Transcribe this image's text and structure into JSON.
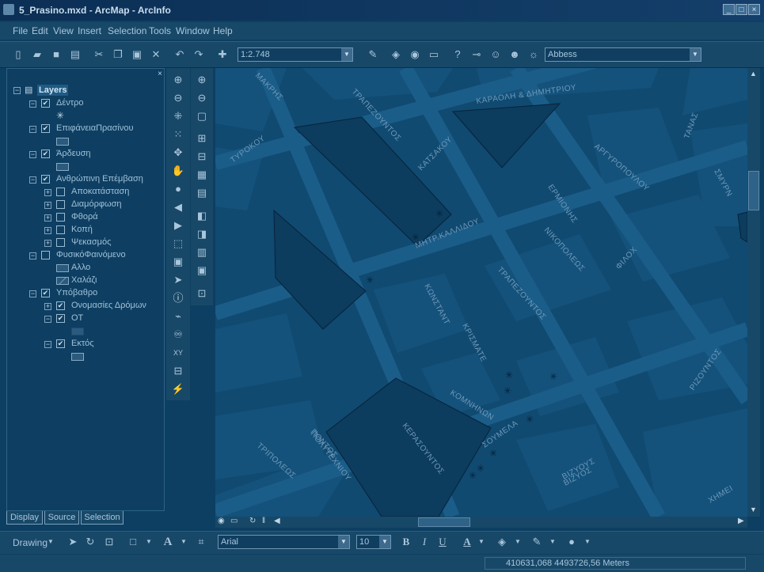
{
  "window": {
    "title": "5_Prasino.mxd - ArcMap - ArcInfo",
    "min": "_",
    "max": "□",
    "close": "×"
  },
  "menus": [
    "File",
    "Edit",
    "View",
    "Insert",
    "Selection",
    "Tools",
    "Window",
    "Help"
  ],
  "toolbar": {
    "scale": "1:2.748",
    "layer_combo": "Abbess"
  },
  "toc": {
    "root": "Layers",
    "rows": [
      {
        "label": "Δέντρο"
      },
      {
        "label": "ΕπιφάνειαΠρασίνου"
      },
      {
        "label": "Άρδευση"
      },
      {
        "label": "Ανθρώπινη Επέμβαση"
      },
      {
        "label": "Αποκατάσταση"
      },
      {
        "label": "Διαμόρφωση"
      },
      {
        "label": "Φθορά"
      },
      {
        "label": "Κοπή"
      },
      {
        "label": "Ψεκασμός"
      },
      {
        "label": "ΦυσικόΦαινόμενο"
      },
      {
        "label": "Αλλο"
      },
      {
        "label": "Χαλάζι"
      },
      {
        "label": "Υπόβαθρο"
      },
      {
        "label": "Ονομασίες Δρόμων"
      },
      {
        "label": "ΟΤ"
      },
      {
        "label": "Εκτός"
      }
    ],
    "tabs": [
      "Display",
      "Source",
      "Selection"
    ]
  },
  "map": {
    "streets": [
      "ΜΑΚΡΗΣ",
      "ΤΡΑΠΕΖΟΥΝΤΟΣ",
      "ΚΑΡΑΟΛΗ & ΔΗΜΗΤΡΙΟΥ",
      "ΤΑΝΑΣ",
      "ΤΥΡΟΚΟΥ",
      "ΚΑΤΣΑΚΟΥ",
      "ΑΡΓΥΡΟΠΟΥΛΟΥ",
      "ΣΜΥΡΝ",
      "ΕΡΜΙΟΝΗΣ",
      "ΜΗΤΡ.ΚΑΛΛΙΔΟΥ",
      "ΝΙΚΟΠΟΛΕΩΣ",
      "ΦΙΛΟΧ",
      "ΤΡΑΠΕΖΟΥΝΤΟΣ",
      "ΚΩΝΣΤΑΝΤ",
      "ΚΡΙΣΜΑΤΕ",
      "ΠΟΝΤΟΣ",
      "ΚΟΜΝΗΝΩΝ",
      "ΣΟΥΜΕΛΑ",
      "ΒΙΖΥΟΣ",
      "ΡΙΖΟΥΝΤΟΣ",
      "ΤΡΙΠΟΛΕΩΣ",
      "ΠΟΛΥΤΕΧΝΙΟΥ",
      "ΚΕΡΑΣΟΥΝΤΟΣ",
      "ΒΙΖΥΟΥΣ",
      "ΧΗΜΕΙ"
    ]
  },
  "drawbar": {
    "drawing": "Drawing",
    "font": "Arial",
    "size": "10",
    "bold": "B",
    "italic": "I",
    "underline": "U"
  },
  "status": {
    "coords": "410631,068  4493726,56 Meters"
  }
}
